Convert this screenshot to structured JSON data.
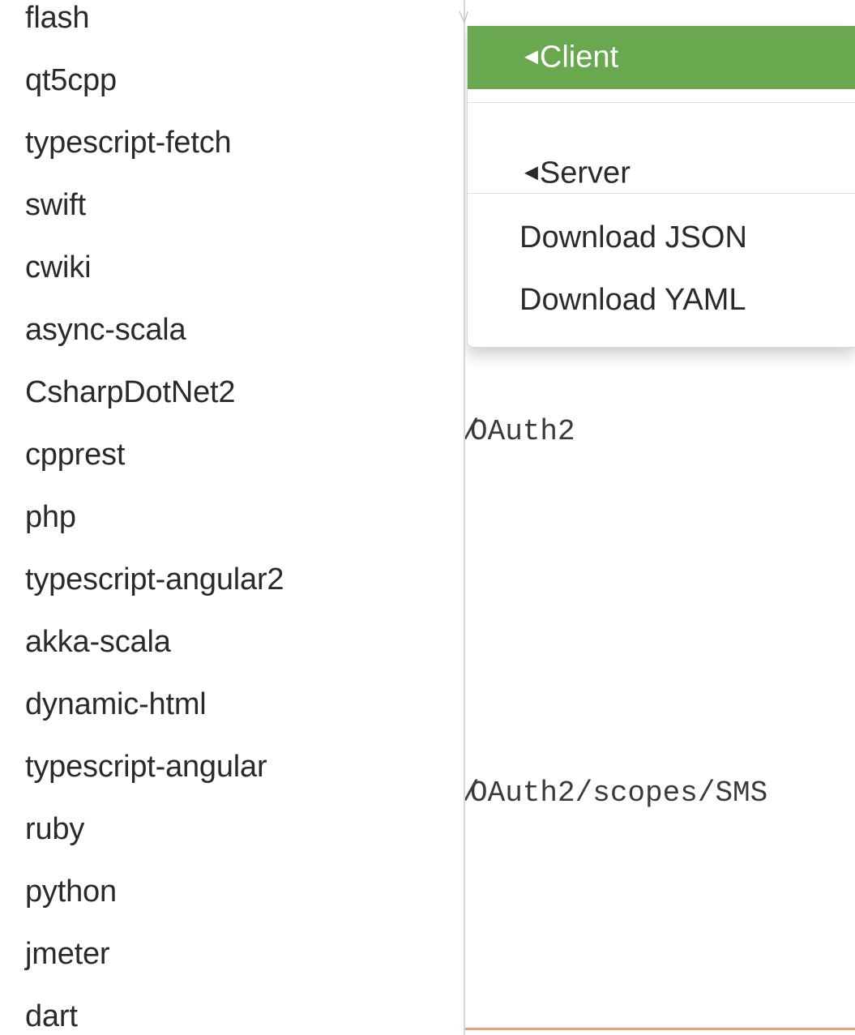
{
  "languages": [
    "flash",
    "qt5cpp",
    "typescript-fetch",
    "swift",
    "cwiki",
    "async-scala",
    "CsharpDotNet2",
    "cpprest",
    "php",
    "typescript-angular2",
    "akka-scala",
    "dynamic-html",
    "typescript-angular",
    "ruby",
    "python",
    "jmeter",
    "dart"
  ],
  "dropdown": {
    "client_label": "Client",
    "server_label": "Server",
    "download_json": "Download JSON",
    "download_yaml": "Download YAML",
    "caret": "◀"
  },
  "page": {
    "code_line_1": "OAuth2",
    "code_line_2": "OAuth2/scopes/SMS",
    "code_prefix": "/"
  },
  "colors": {
    "active_item": "#6aa84f",
    "bottom_accent": "#f0a070"
  }
}
